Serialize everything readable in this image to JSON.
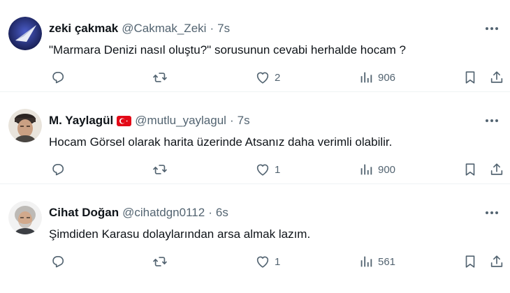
{
  "tweets": [
    {
      "name": "zeki çakmak",
      "handle": "@Cakmak_Zeki",
      "separator": "·",
      "time": "7s",
      "text": "\"Marmara Denizi nasıl oluştu?\" sorusunun cevabi herhalde hocam ?",
      "replies": "",
      "retweets": "",
      "likes": "2",
      "views": "906"
    },
    {
      "name": "M. Yaylagül",
      "handle": "@mutlu_yaylagul",
      "separator": "·",
      "time": "7s",
      "text": "Hocam Görsel olarak harita üzerinde Atsanız daha verimli olabilir.",
      "replies": "",
      "retweets": "",
      "likes": "1",
      "views": "900"
    },
    {
      "name": "Cihat Doğan",
      "handle": "@cihatdgn0112",
      "separator": "·",
      "time": "6s",
      "text": "Şimdiden Karasu dolaylarından arsa almak lazım.",
      "replies": "",
      "retweets": "",
      "likes": "1",
      "views": "561"
    }
  ],
  "colors": {
    "text": "#0f1419",
    "secondary": "#536471",
    "divider": "#eff3f4",
    "flag_red": "#e30a17"
  },
  "icons": {
    "reply": "reply-icon",
    "retweet": "retweet-icon",
    "like": "heart-icon",
    "views": "views-bar-chart-icon",
    "bookmark": "bookmark-icon",
    "share": "share-icon",
    "more": "more-dots-icon",
    "flag": "turkey-flag-icon"
  }
}
